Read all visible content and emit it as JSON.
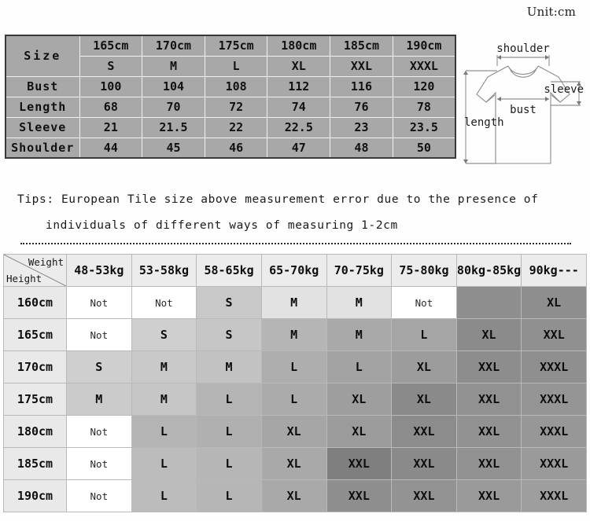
{
  "unit_label": "Unit:cm",
  "size_table": {
    "corner_label": "Size",
    "height_headers": [
      "165cm",
      "170cm",
      "175cm",
      "180cm",
      "185cm",
      "190cm"
    ],
    "size_headers": [
      "S",
      "M",
      "L",
      "XL",
      "XXL",
      "XXXL"
    ],
    "rows": [
      {
        "label": "Bust",
        "values": [
          "100",
          "104",
          "108",
          "112",
          "116",
          "120"
        ]
      },
      {
        "label": "Length",
        "values": [
          "68",
          "70",
          "72",
          "74",
          "76",
          "78"
        ]
      },
      {
        "label": "Sleeve",
        "values": [
          "21",
          "21.5",
          "22",
          "22.5",
          "23",
          "23.5"
        ]
      },
      {
        "label": "Shoulder",
        "values": [
          "44",
          "45",
          "46",
          "47",
          "48",
          "50"
        ]
      }
    ]
  },
  "diagram": {
    "shoulder_label": "shoulder",
    "sleeve_label": "sleeve",
    "bust_label": "bust",
    "length_label": "length"
  },
  "tips": {
    "line1": "Tips: European Tile size above measurement error due to the presence of",
    "line2": "individuals of different ways of measuring 1-2cm"
  },
  "fit_table": {
    "corner_weight": "Weight",
    "corner_height": "Height",
    "weight_headers": [
      "48-53kg",
      "53-58kg",
      "58-65kg",
      "65-70kg",
      "70-75kg",
      "75-80kg",
      "80kg-85kg",
      "90kg---"
    ],
    "rows": [
      {
        "height": "160cm",
        "cells": [
          "Not",
          "Not",
          "S",
          "M",
          "M",
          "Not",
          "",
          "XL"
        ]
      },
      {
        "height": "165cm",
        "cells": [
          "Not",
          "S",
          "S",
          "M",
          "M",
          "L",
          "XL",
          "XXL"
        ]
      },
      {
        "height": "170cm",
        "cells": [
          "S",
          "M",
          "M",
          "L",
          "L",
          "XL",
          "XXL",
          "XXXL"
        ]
      },
      {
        "height": "175cm",
        "cells": [
          "M",
          "M",
          "L",
          "L",
          "XL",
          "XL",
          "XXL",
          "XXXL"
        ]
      },
      {
        "height": "180cm",
        "cells": [
          "Not",
          "L",
          "L",
          "XL",
          "XL",
          "XXL",
          "XXL",
          "XXXL"
        ]
      },
      {
        "height": "185cm",
        "cells": [
          "Not",
          "L",
          "L",
          "XL",
          "XXL",
          "XXL",
          "XXL",
          "XXXL"
        ]
      },
      {
        "height": "190cm",
        "cells": [
          "Not",
          "L",
          "L",
          "XL",
          "XXL",
          "XXL",
          "XXL",
          "XXXL"
        ]
      }
    ],
    "cell_shades": [
      [
        "#ffffff",
        "#ffffff",
        "#c8c8c8",
        "#e2e2e2",
        "#e2e2e2",
        "#ffffff",
        "#8e8e8e",
        "#8e8e8e"
      ],
      [
        "#ffffff",
        "#cfcfcf",
        "#c6c6c6",
        "#b5b5b5",
        "#a9a9a9",
        "#a5a5a5",
        "#8b8b8b",
        "#909090"
      ],
      [
        "#cfcfcf",
        "#c9c9c9",
        "#c2c2c2",
        "#aeaeae",
        "#a3a3a3",
        "#9c9c9c",
        "#8d8d8d",
        "#8f8f8f"
      ],
      [
        "#cbcbcb",
        "#c6c6c6",
        "#b4b4b4",
        "#ababab",
        "#9e9e9e",
        "#8a8a8a",
        "#919191",
        "#959595"
      ],
      [
        "#ffffff",
        "#b4b4b4",
        "#b0b0b0",
        "#a6a6a6",
        "#9b9b9b",
        "#8c8c8c",
        "#929292",
        "#979797"
      ],
      [
        "#ffffff",
        "#bcbcbc",
        "#b6b6b6",
        "#a9a9a9",
        "#7f7f7f",
        "#8a8a8a",
        "#929292",
        "#9a9a9a"
      ],
      [
        "#ffffff",
        "#bcbcbc",
        "#b6b6b6",
        "#a9a9a9",
        "#8e8e8e",
        "#939393",
        "#9a9a9a",
        "#9e9e9e"
      ]
    ]
  },
  "colors": {
    "size_table_header_bg": "#000000",
    "size_table_subheader_bg": "#4b4b4b",
    "size_table_body_bg": "#a8a8a8",
    "fit_header_bg": "#ececec"
  }
}
